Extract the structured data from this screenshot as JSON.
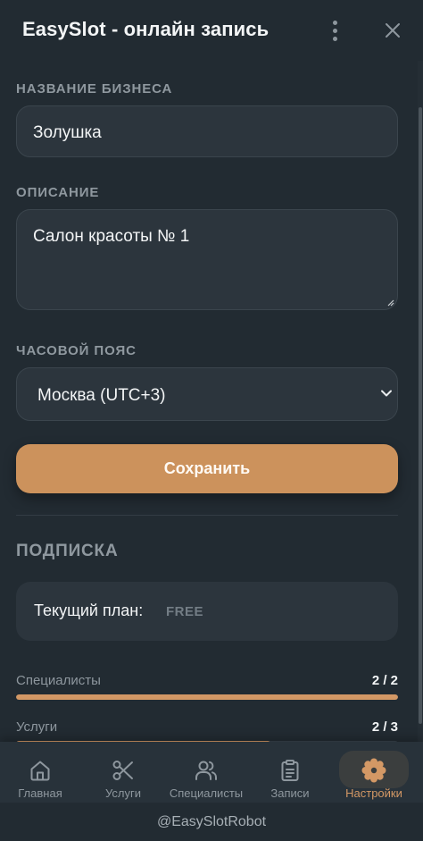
{
  "header": {
    "title": "EasySlot - онлайн запись"
  },
  "business": {
    "name_label": "НАЗВАНИЕ БИЗНЕСА",
    "name_value": "Золушка",
    "description_label": "ОПИСАНИЕ",
    "description_value": "Салон красоты № 1",
    "timezone_label": "ЧАСОВОЙ ПОЯС",
    "timezone_value": "Москва (UTC+3)",
    "save_label": "Сохранить"
  },
  "subscription": {
    "title": "ПОДПИСКА",
    "plan_label": "Текущий план:",
    "plan_value": "FREE",
    "usage": [
      {
        "name": "Специалисты",
        "count": "2 / 2",
        "fraction": 1.0
      },
      {
        "name": "Услуги",
        "count": "2 / 3",
        "fraction": 0.667
      }
    ]
  },
  "nav": {
    "items": [
      {
        "label": "Главная",
        "icon": "home-icon"
      },
      {
        "label": "Услуги",
        "icon": "scissors-icon"
      },
      {
        "label": "Специалисты",
        "icon": "users-icon"
      },
      {
        "label": "Записи",
        "icon": "clipboard-icon"
      },
      {
        "label": "Настройки",
        "icon": "gear-icon",
        "active": true
      }
    ]
  },
  "footer": {
    "bot_handle": "@EasySlotRobot"
  },
  "colors": {
    "accent": "#cc925c",
    "background": "#222b32",
    "field": "#2c353d"
  }
}
